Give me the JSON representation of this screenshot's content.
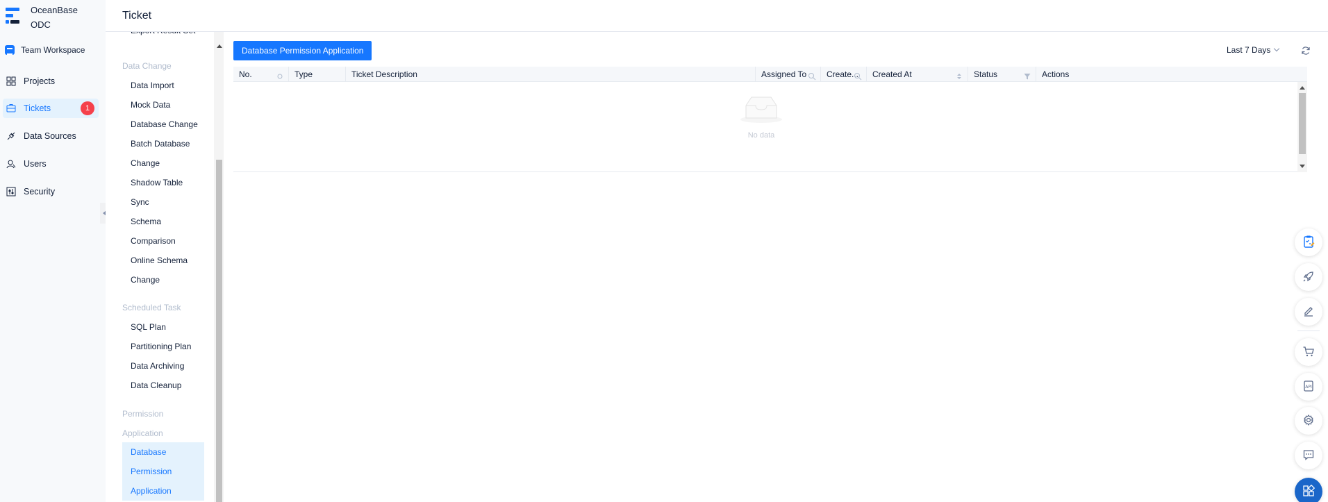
{
  "app": {
    "logo_line1": "OceanBase",
    "logo_line2": "ODC",
    "workspace": "Team Workspace"
  },
  "sidebar": {
    "items": [
      {
        "label": "Projects",
        "icon": "grid-icon"
      },
      {
        "label": "Tickets",
        "icon": "ticket-icon",
        "badge": "1"
      },
      {
        "label": "Data Sources",
        "icon": "plug-icon"
      },
      {
        "label": "Users",
        "icon": "user-icon"
      },
      {
        "label": "Security",
        "icon": "sliders-icon"
      }
    ]
  },
  "header": {
    "title": "Ticket"
  },
  "menu": {
    "partial_item": "Export Result Set",
    "groups": [
      {
        "label": "Data Change",
        "items": [
          "Data Import",
          "Mock Data",
          "Database Change",
          "Batch Database",
          "Change",
          "Shadow Table",
          "Sync",
          "Schema",
          "Comparison",
          "Online Schema",
          "Change"
        ]
      },
      {
        "label": "Scheduled Task",
        "items": [
          "SQL Plan",
          "Partitioning Plan",
          "Data Archiving",
          "Data Cleanup"
        ]
      },
      {
        "label_line1": "Permission",
        "label_line2": "Application",
        "items": [
          "Database",
          "Permission",
          "Application"
        ]
      }
    ]
  },
  "toolbar": {
    "primary_button": "Database Permission Application",
    "range": "Last 7 Days"
  },
  "table": {
    "columns": [
      "No.",
      "Type",
      "Ticket Description",
      "Assigned To",
      "Create...",
      "Created At",
      "Status",
      "Actions"
    ],
    "empty_text": "No data"
  },
  "colors": {
    "accent": "#1677ff",
    "badge": "#f5414b",
    "selected_bg": "#e4f2fd"
  }
}
